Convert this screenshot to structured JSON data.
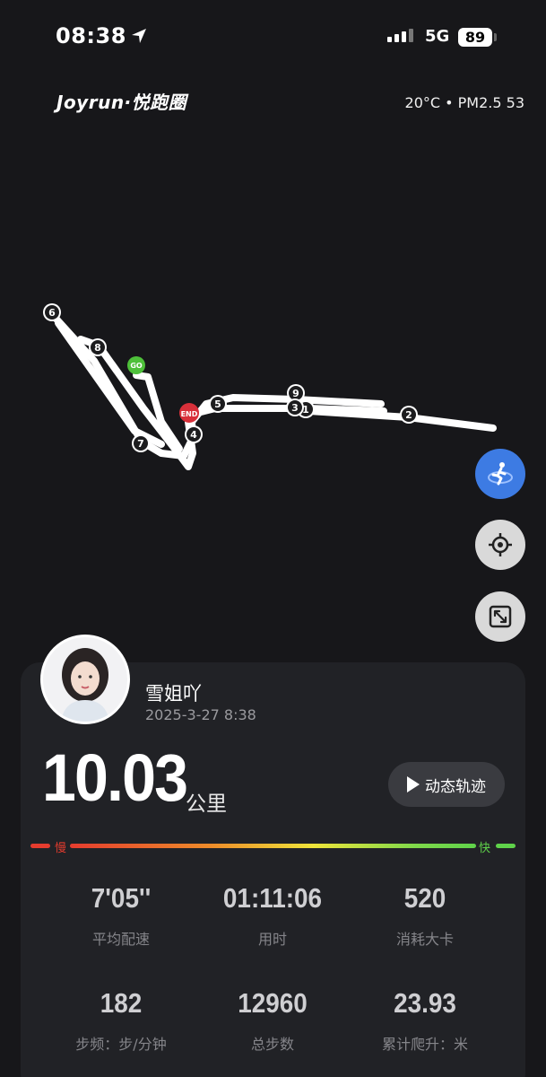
{
  "status_bar": {
    "time": "08:38",
    "network": "5G",
    "battery": "89"
  },
  "header": {
    "brand": "Joyrun·悦跑圈",
    "weather": "20°C • PM2.5 53"
  },
  "map": {
    "start_label": "GO",
    "end_label": "END",
    "km_markers": [
      "1",
      "2",
      "3",
      "4",
      "5",
      "6",
      "7",
      "8",
      "9"
    ]
  },
  "controls": {
    "mode_icon": "runner-globe-icon",
    "locate_icon": "crosshair-icon",
    "expand_icon": "fullscreen-icon"
  },
  "user": {
    "name": "雪姐吖",
    "date": "2025-3-27 8:38"
  },
  "summary": {
    "distance": "10.03",
    "unit": "公里",
    "replay_label": "动态轨迹"
  },
  "pace_legend": {
    "slow": "慢",
    "fast": "快"
  },
  "stats": [
    {
      "value": "7'05''",
      "label": "平均配速"
    },
    {
      "value": "01:11:06",
      "label": "用时"
    },
    {
      "value": "520",
      "label": "消耗大卡"
    },
    {
      "value": "182",
      "label": "步频：步/分钟"
    },
    {
      "value": "12960",
      "label": "总步数"
    },
    {
      "value": "23.93",
      "label": "累计爬升：米"
    }
  ],
  "colors": {
    "background": "#17171a",
    "card": "#212226",
    "accent_blue": "#3d7be3",
    "slow": "#e53c2e",
    "fast": "#5fd24a"
  }
}
